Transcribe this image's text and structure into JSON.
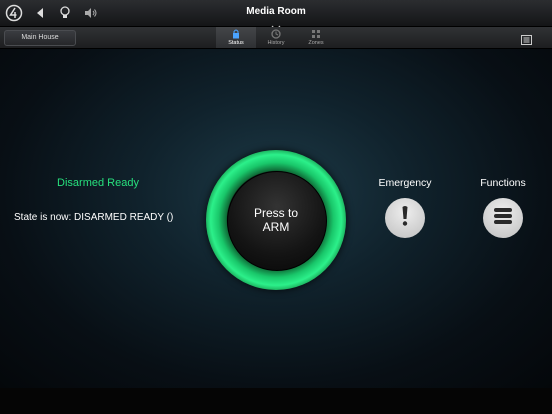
{
  "header": {
    "title": "Media Room"
  },
  "subbar": {
    "house": "Main House",
    "tabs": [
      {
        "label": "Status",
        "icon": "lock-icon",
        "active": true
      },
      {
        "label": "History",
        "icon": "history-icon",
        "active": false
      },
      {
        "label": "Zones",
        "icon": "zones-icon",
        "active": false
      }
    ]
  },
  "status": {
    "label": "Disarmed Ready",
    "state_text": "State is now: DISARMED READY ()",
    "accent": "#27e07d"
  },
  "arm": {
    "label_line1": "Press to",
    "label_line2": "ARM",
    "ring_color": "#2cf08a"
  },
  "emergency": {
    "label": "Emergency",
    "icon": "exclamation-icon"
  },
  "functions": {
    "label": "Functions",
    "icon": "list-icon"
  },
  "toolbar_icons": [
    "control4-logo-icon",
    "back-icon",
    "lightbulb-icon",
    "volume-icon",
    "menu-icon"
  ]
}
